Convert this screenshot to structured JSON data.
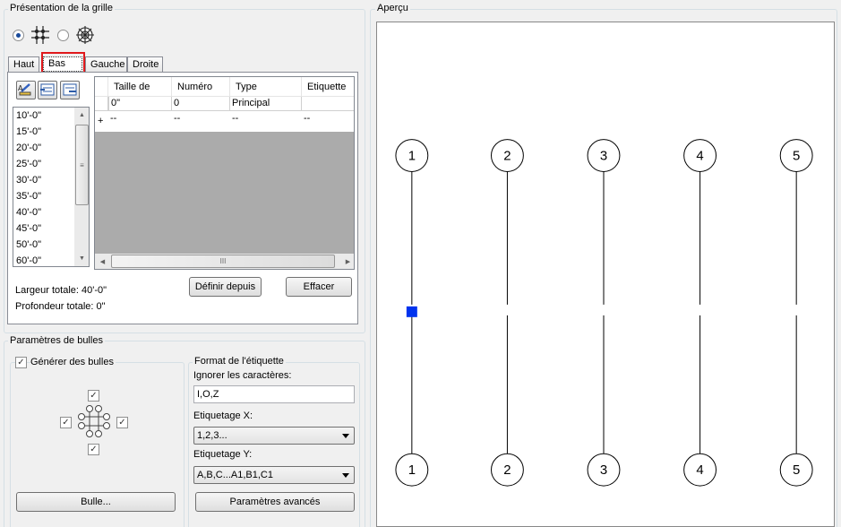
{
  "grid_presentation": {
    "title": "Présentation de la grille",
    "tabs": [
      "Haut",
      "Bas",
      "Gauche",
      "Droite"
    ],
    "active_tab": "Bas",
    "spacing_list": [
      "10'-0\"",
      "15'-0\"",
      "20'-0\"",
      "25'-0\"",
      "30'-0\"",
      "35'-0\"",
      "40'-0\"",
      "45'-0\"",
      "50'-0\"",
      "60'-0\""
    ],
    "table": {
      "columns": [
        "Taille de",
        "Numéro",
        "Type",
        "Etiquette"
      ],
      "rows": [
        [
          "0\"",
          "0",
          "Principal",
          ""
        ],
        [
          "--",
          "--",
          "--",
          "--"
        ]
      ],
      "new_row_marker": "+"
    },
    "define_from_button": "Définir depuis",
    "clear_button": "Effacer",
    "total_width": "Largeur totale: 40'-0\"",
    "total_depth": "Profondeur totale: 0\"",
    "scroll_thumb_glyph": "III"
  },
  "bubble_params": {
    "title": "Paramètres de bulles",
    "generate_bubbles_label": "Générer des bulles",
    "generate_bubbles_checked": true,
    "bubble_button": "Bulle...",
    "label_format": {
      "title": "Format de l'étiquette",
      "ignore_chars_label": "Ignorer les caractères:",
      "ignore_chars_value": "I,O,Z",
      "x_label": "Etiquetage X:",
      "x_value": "1,2,3...",
      "y_label": "Etiquetage Y:",
      "y_value": "A,B,C...A1,B1,C1",
      "advanced_button": "Paramètres avancés"
    }
  },
  "preview": {
    "title": "Aperçu",
    "top_bubbles": [
      "1",
      "2",
      "3",
      "4",
      "5"
    ],
    "bottom_bubbles": [
      "1",
      "2",
      "3",
      "4",
      "5"
    ],
    "handle_color": "#0033ee"
  },
  "colors": {
    "highlight": "#e0191c"
  }
}
